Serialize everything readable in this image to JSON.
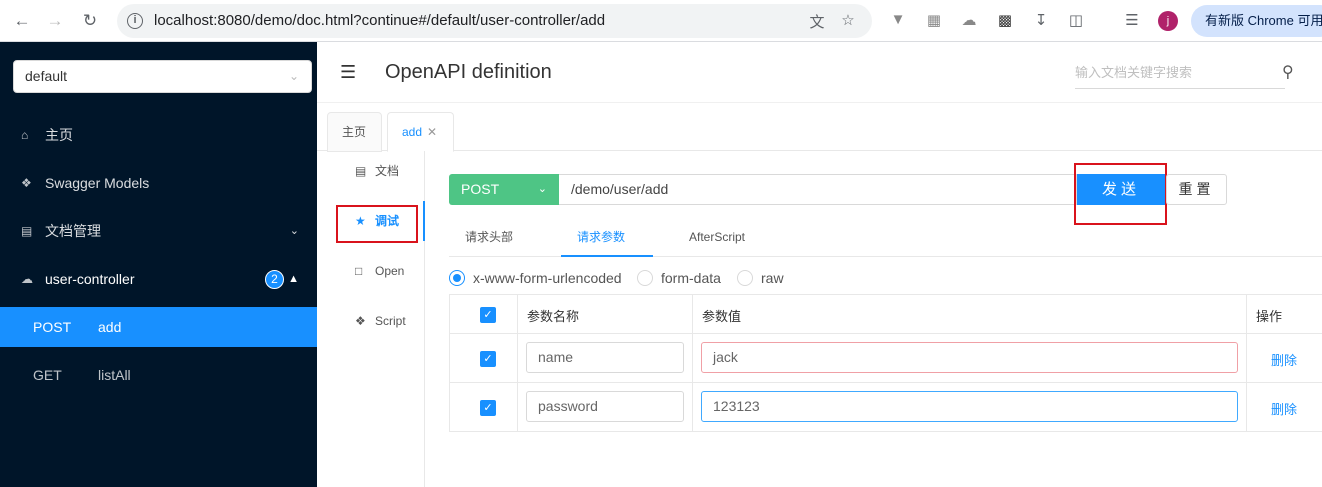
{
  "browser": {
    "url": "localhost:8080/demo/doc.html?continue#/default/user-controller/add",
    "update_button": "有新版 Chrome 可用",
    "profile_initial": "j"
  },
  "sidebar": {
    "group_select": "default",
    "items": [
      {
        "label": "主页",
        "icon": "home-icon"
      },
      {
        "label": "Swagger Models",
        "icon": "models-icon"
      },
      {
        "label": "文档管理",
        "icon": "doc-manage-icon"
      },
      {
        "label": "user-controller",
        "icon": "cloud-icon",
        "badge": "2"
      }
    ],
    "endpoints": [
      {
        "method": "POST",
        "path": "add",
        "active": true
      },
      {
        "method": "GET",
        "path": "listAll",
        "active": false
      }
    ]
  },
  "header": {
    "title": "OpenAPI definition",
    "search_placeholder": "输入文档关键字搜索"
  },
  "tabs": [
    {
      "label": "主页"
    },
    {
      "label": "add",
      "closable": true
    }
  ],
  "leftnav": [
    {
      "label": "文档",
      "icon": "doc-icon"
    },
    {
      "label": "调试",
      "icon": "debug-icon"
    },
    {
      "label": "Open",
      "icon": "file-icon"
    },
    {
      "label": "Script",
      "icon": "code-icon"
    }
  ],
  "request": {
    "method": "POST",
    "url": "/demo/user/add",
    "send_label": "发送",
    "reset_label": "重置",
    "subtabs": [
      "请求头部",
      "请求参数",
      "AfterScript"
    ],
    "active_subtab": "请求参数",
    "content_types": [
      "x-www-form-urlencoded",
      "form-data",
      "raw"
    ],
    "selected_content_type": "x-www-form-urlencoded",
    "columns": [
      "参数名称",
      "参数值",
      "操作"
    ],
    "params": [
      {
        "name": "name",
        "value": "jack",
        "action": "删除"
      },
      {
        "name": "password",
        "value": "123123",
        "action": "删除"
      }
    ]
  },
  "colors": {
    "accent": "#1890ff",
    "post_green": "#4ec585",
    "sidebar_bg": "#001529",
    "highlight_red": "#d9131c"
  }
}
